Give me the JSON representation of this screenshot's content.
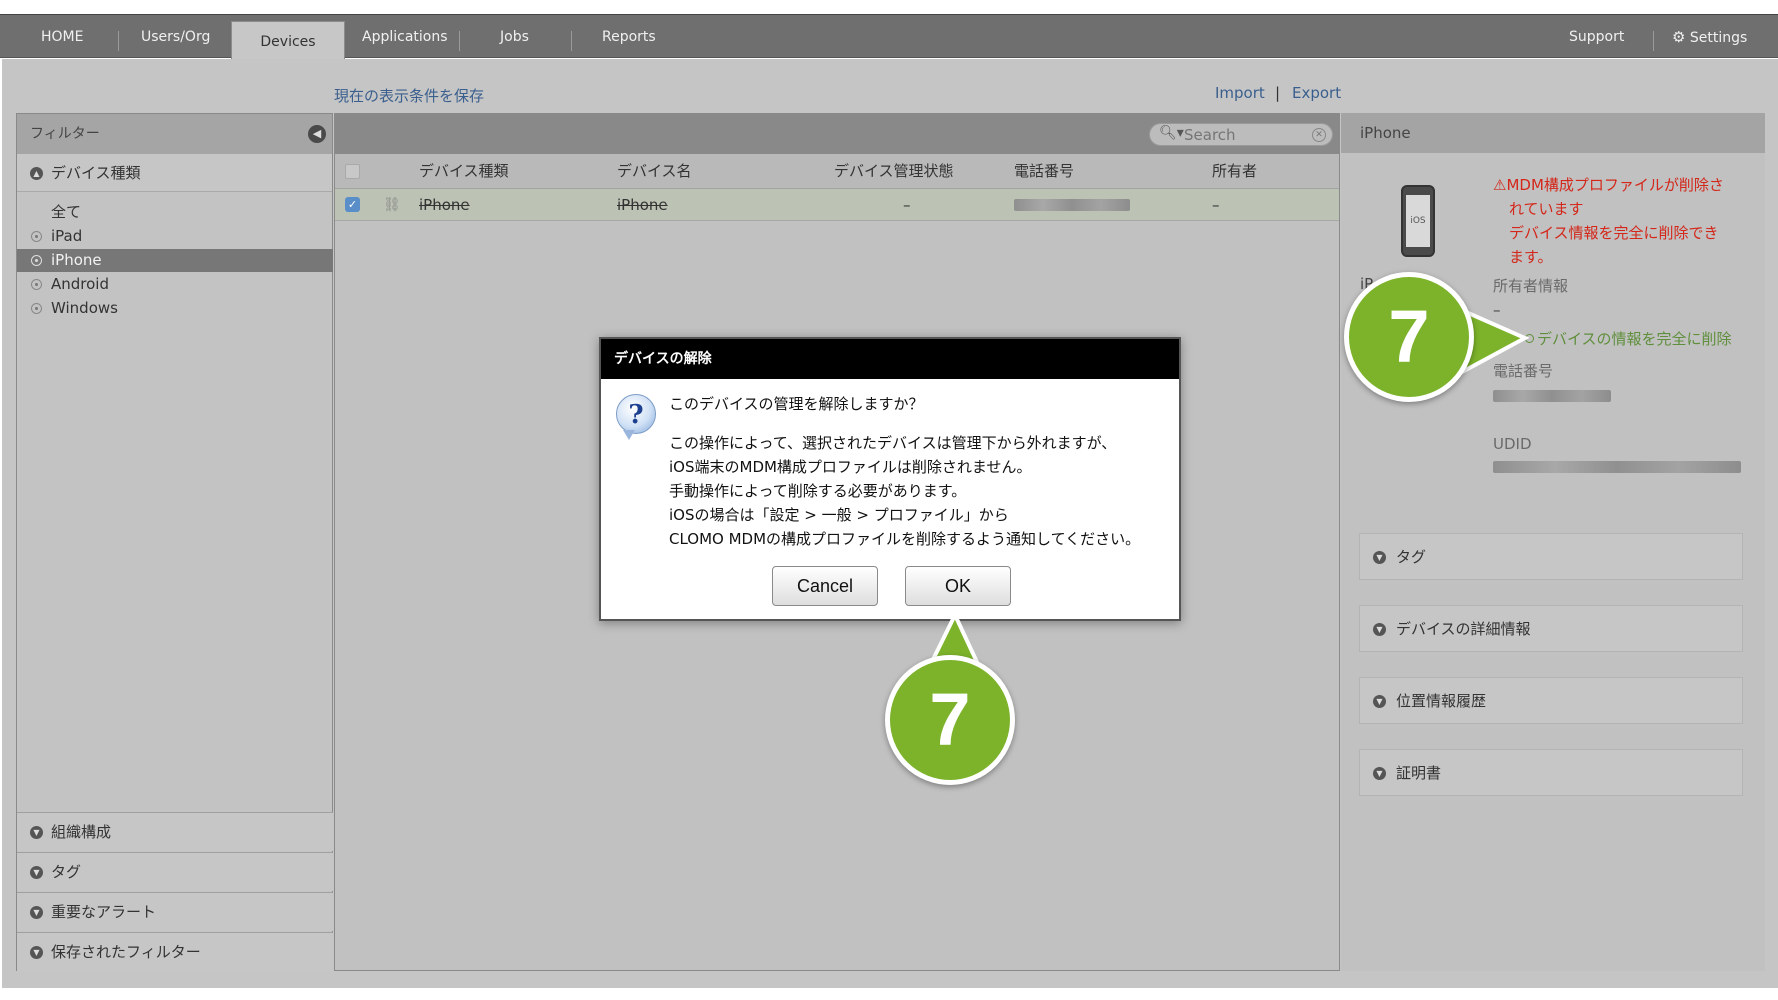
{
  "nav": {
    "items": [
      "HOME",
      "Users/Org",
      "Devices",
      "Applications",
      "Jobs",
      "Reports"
    ],
    "active": "Devices",
    "support": "Support",
    "settings": "Settings"
  },
  "toolbar": {
    "save_view": "現在の表示条件を保存",
    "import": "Import",
    "separator": "|",
    "export": "Export"
  },
  "filter": {
    "title": "フィルター",
    "device_type_heading": "デバイス種類",
    "options": [
      "全て",
      "iPad",
      "iPhone",
      "Android",
      "Windows"
    ],
    "selected": "iPhone",
    "bottom_sections": [
      "組織構成",
      "タグ",
      "重要なアラート",
      "保存されたフィルター"
    ]
  },
  "list": {
    "search_placeholder": "Search",
    "columns": [
      "デバイス種類",
      "デバイス名",
      "デバイス管理状態",
      "電話番号",
      "所有者"
    ],
    "rows": [
      {
        "type": "iPhone",
        "name": "iPhone",
        "status": "–",
        "owner": "–",
        "checked": true
      }
    ]
  },
  "detail": {
    "title": "iPhone",
    "device_label": "iP",
    "phone_screen": "iOS",
    "warning_line1": "MDM構成プロファイルが削除さ",
    "warning_line2": "れています",
    "warning_line3": "デバイス情報を完全に削除でき",
    "warning_line4": "ます。",
    "owner_label": "所有者情報",
    "owner_value": "–",
    "delete_link": "デバイスの情報を完全に削除",
    "phone_label": "電話番号",
    "udid_label": "UDID",
    "sections": [
      "タグ",
      "デバイスの詳細情報",
      "位置情報履歴",
      "証明書"
    ]
  },
  "dialog": {
    "title": "デバイスの解除",
    "question": "このデバイスの管理を解除しますか？",
    "body": [
      "この操作によって、選択されたデバイスは管理下から外れますが、",
      "iOS端末のMDM構成プロファイルは削除されません。",
      "手動操作によって削除する必要があります。",
      "iOSの場合は「設定 > 一般 > プロファイル」から",
      "CLOMO MDMの構成プロファイルを削除するよう通知してください。"
    ],
    "cancel": "Cancel",
    "ok": "OK"
  },
  "markers": [
    "7",
    "7"
  ],
  "colors": {
    "nav_bg": "#6f6f6f",
    "warning": "#d4271a",
    "link": "#3a5f8e",
    "delete_link": "#5f8f3c",
    "marker": "#7cb32a"
  }
}
